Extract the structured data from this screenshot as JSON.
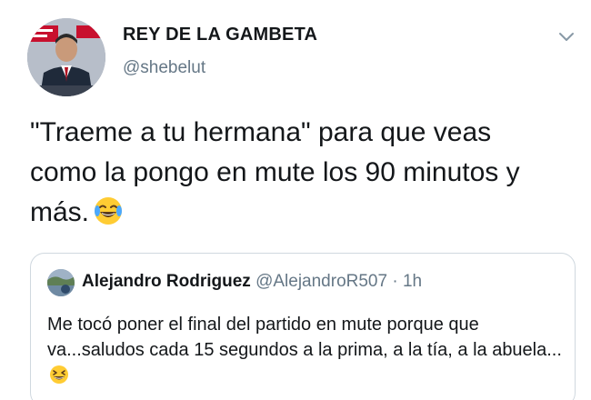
{
  "tweet": {
    "display_name": "REY DE LA GAMBETA",
    "handle": "@shebelut",
    "text": "\"Traeme a tu hermana\" para que veas como la pongo en mute los 90 minutos y más.",
    "text_emoji": "face-with-tears-of-joy-icon",
    "menu_icon": "chevron-down-icon"
  },
  "quoted_tweet": {
    "display_name": "Alejandro Rodriguez",
    "handle": "@AlejandroR507",
    "separator": "·",
    "time": "1h",
    "text": "Me tocó poner el final del partido en mute porque que va...saludos cada  15 segundos a la prima, a la tía, a la abuela...",
    "text_emoji": "grinning-squinting-face-icon"
  },
  "colors": {
    "text": "#14171a",
    "secondary": "#657786",
    "border": "#d0d8df"
  }
}
